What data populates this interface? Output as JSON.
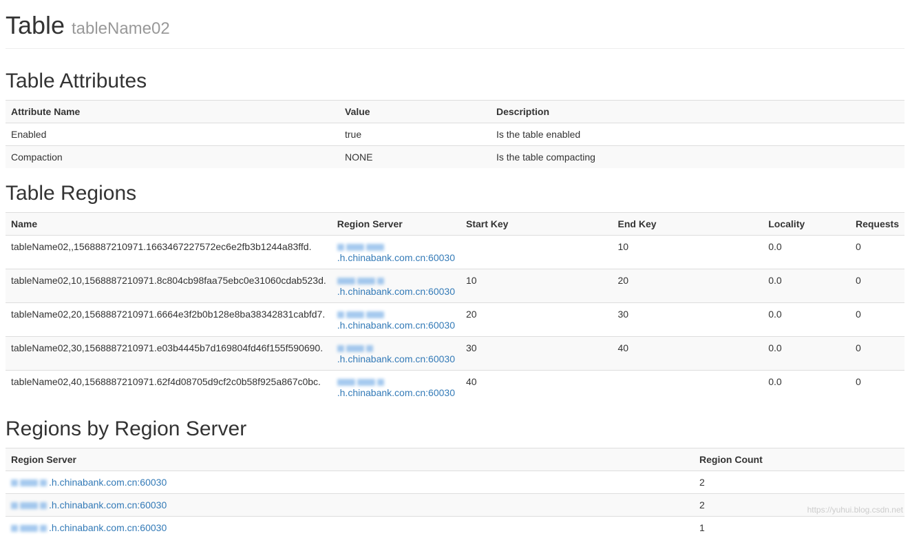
{
  "header": {
    "title": "Table",
    "subtitle": "tableName02"
  },
  "attributes": {
    "heading": "Table Attributes",
    "columns": {
      "name": "Attribute Name",
      "value": "Value",
      "desc": "Description"
    },
    "rows": [
      {
        "name": "Enabled",
        "value": "true",
        "desc": "Is the table enabled"
      },
      {
        "name": "Compaction",
        "value": "NONE",
        "desc": "Is the table compacting"
      }
    ]
  },
  "regions": {
    "heading": "Table Regions",
    "columns": {
      "name": "Name",
      "server": "Region Server",
      "startKey": "Start Key",
      "endKey": "End Key",
      "locality": "Locality",
      "requests": "Requests"
    },
    "rows": [
      {
        "name": "tableName02,,1568887210971.1663467227572ec6e2fb3b1244a83ffd.",
        "server": ".h.chinabank.com.cn:60030",
        "startKey": "",
        "endKey": "10",
        "locality": "0.0",
        "requests": "0"
      },
      {
        "name": "tableName02,10,1568887210971.8c804cb98faa75ebc0e31060cdab523d.",
        "server": ".h.chinabank.com.cn:60030",
        "startKey": "10",
        "endKey": "20",
        "locality": "0.0",
        "requests": "0"
      },
      {
        "name": "tableName02,20,1568887210971.6664e3f2b0b128e8ba38342831cabfd7.",
        "server": ".h.chinabank.com.cn:60030",
        "startKey": "20",
        "endKey": "30",
        "locality": "0.0",
        "requests": "0"
      },
      {
        "name": "tableName02,30,1568887210971.e03b4445b7d169804fd46f155f590690.",
        "server": ".h.chinabank.com.cn:60030",
        "startKey": "30",
        "endKey": "40",
        "locality": "0.0",
        "requests": "0"
      },
      {
        "name": "tableName02,40,1568887210971.62f4d08705d9cf2c0b58f925a867c0bc.",
        "server": ".h.chinabank.com.cn:60030",
        "startKey": "40",
        "endKey": "",
        "locality": "0.0",
        "requests": "0"
      }
    ]
  },
  "byServer": {
    "heading": "Regions by Region Server",
    "columns": {
      "server": "Region Server",
      "count": "Region Count"
    },
    "rows": [
      {
        "server": ".h.chinabank.com.cn:60030",
        "count": "2"
      },
      {
        "server": ".h.chinabank.com.cn:60030",
        "count": "2"
      },
      {
        "server": ".h.chinabank.com.cn:60030",
        "count": "1"
      }
    ]
  },
  "watermark": "https://yuhui.blog.csdn.net"
}
